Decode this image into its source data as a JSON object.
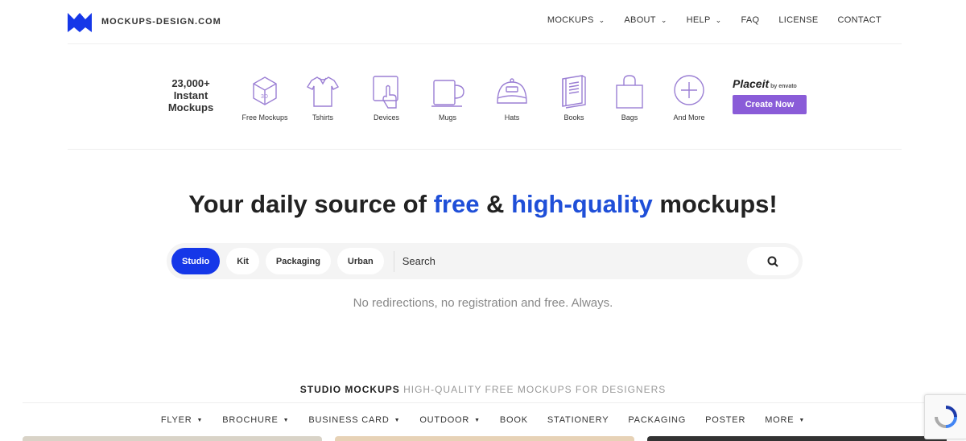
{
  "header": {
    "brand": "MOCKUPS-DESIGN.COM",
    "nav": [
      {
        "label": "MOCKUPS",
        "dropdown": true
      },
      {
        "label": "ABOUT",
        "dropdown": true
      },
      {
        "label": "HELP",
        "dropdown": true
      },
      {
        "label": "FAQ",
        "dropdown": false
      },
      {
        "label": "LICENSE",
        "dropdown": false
      },
      {
        "label": "CONTACT",
        "dropdown": false
      }
    ]
  },
  "promo": {
    "count_line1": "23,000+",
    "count_line2": "Instant",
    "count_line3": "Mockups",
    "categories": [
      {
        "label": "Free Mockups",
        "icon": "3d-box-icon"
      },
      {
        "label": "Tshirts",
        "icon": "tshirt-icon"
      },
      {
        "label": "Devices",
        "icon": "device-icon"
      },
      {
        "label": "Mugs",
        "icon": "mug-icon"
      },
      {
        "label": "Hats",
        "icon": "hat-icon"
      },
      {
        "label": "Books",
        "icon": "book-icon"
      },
      {
        "label": "Bags",
        "icon": "bag-icon"
      },
      {
        "label": "And More",
        "icon": "plus-circle-icon"
      }
    ],
    "placeit_logo": "Placeit",
    "placeit_by": "by envato",
    "cta_label": "Create Now"
  },
  "hero": {
    "part1": "Your daily source of ",
    "highlight1": "free",
    "part2": " & ",
    "highlight2": "high-quality",
    "part3": " mockups!",
    "tagline": "No redirections, no registration and free. Always."
  },
  "search": {
    "tabs": [
      {
        "label": "Studio",
        "active": true
      },
      {
        "label": "Kit",
        "active": false
      },
      {
        "label": "Packaging",
        "active": false
      },
      {
        "label": "Urban",
        "active": false
      }
    ],
    "placeholder": "Search"
  },
  "section": {
    "title_bold": "STUDIO MOCKUPS",
    "title_rest": " HIGH-QUALITY FREE MOCKUPS FOR DESIGNERS"
  },
  "category_nav": [
    {
      "label": "FLYER",
      "dropdown": true
    },
    {
      "label": "BROCHURE",
      "dropdown": true
    },
    {
      "label": "BUSINESS CARD",
      "dropdown": true
    },
    {
      "label": "OUTDOOR",
      "dropdown": true
    },
    {
      "label": "BOOK",
      "dropdown": false
    },
    {
      "label": "STATIONERY",
      "dropdown": false
    },
    {
      "label": "PACKAGING",
      "dropdown": false
    },
    {
      "label": "POSTER",
      "dropdown": false
    },
    {
      "label": "MORE",
      "dropdown": true
    }
  ],
  "colors": {
    "brand_blue": "#1537e8",
    "accent_purple": "#8a5cd8",
    "headline_blue": "#1f4fd8",
    "icon_purple": "#9b7fd4"
  }
}
